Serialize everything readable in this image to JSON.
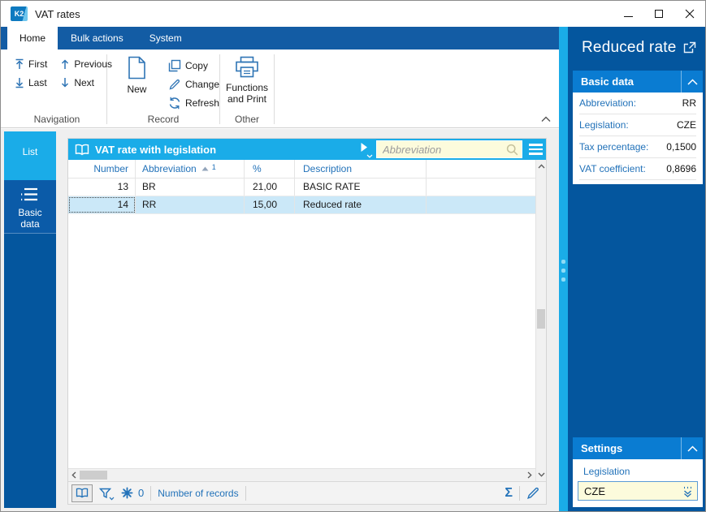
{
  "titlebar": {
    "logo_text": "K2",
    "title": "VAT rates"
  },
  "tabs": {
    "home": "Home",
    "bulk": "Bulk actions",
    "system": "System"
  },
  "ribbon": {
    "navigation": {
      "label": "Navigation",
      "first": "First",
      "previous": "Previous",
      "last": "Last",
      "next": "Next"
    },
    "record": {
      "label": "Record",
      "new": "New",
      "copy": "Copy",
      "change": "Change",
      "refresh": "Refresh"
    },
    "other": {
      "label": "Other",
      "functions_line1": "Functions",
      "functions_line2": "and Print"
    }
  },
  "sidebar": {
    "list": "List",
    "basic_data": "Basic data"
  },
  "grid": {
    "title": "VAT rate with legislation",
    "search_placeholder": "Abbreviation",
    "columns": {
      "number": "Number",
      "abbreviation": "Abbreviation",
      "percent": "%",
      "description": "Description"
    },
    "sort_order": "1",
    "rows": [
      {
        "number": "13",
        "abbreviation": "BR",
        "percent": "21,00",
        "description": "BASIC RATE"
      },
      {
        "number": "14",
        "abbreviation": "RR",
        "percent": "15,00",
        "description": "Reduced rate"
      }
    ],
    "selected_row_index": 1,
    "statusbar": {
      "count": "0",
      "records_label": "Number of records",
      "sigma_glyph": "Σ"
    }
  },
  "panel": {
    "title": "Reduced rate",
    "basic_data": {
      "title": "Basic data",
      "fields": [
        {
          "label": "Abbreviation:",
          "value": "RR"
        },
        {
          "label": "Legislation:",
          "value": "CZE"
        },
        {
          "label": "Tax percentage:",
          "value": "0,1500"
        },
        {
          "label": "VAT coefficient:",
          "value": "0,8696"
        }
      ]
    },
    "settings": {
      "title": "Settings",
      "field_label": "Legislation",
      "field_value": "CZE"
    }
  },
  "colors": {
    "cyan_accent": "#1AACE8",
    "dark_blue": "#04569E",
    "tabbar_blue": "#135CA4",
    "section_header_blue": "#0A7CD2",
    "label_blue": "#2272B9",
    "selected_row": "#CBE8F8",
    "input_yellow": "#FCFBDC"
  }
}
